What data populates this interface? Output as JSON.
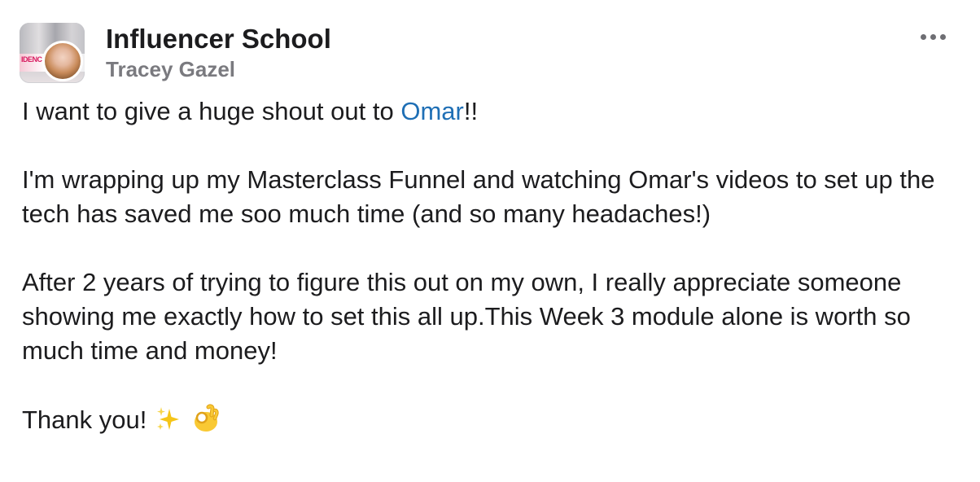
{
  "header": {
    "group_name": "Influencer School",
    "author_name": "Tracey Gazel",
    "avatar_tag": "IDENC"
  },
  "more_menu": {
    "icon": "more-horizontal-icon"
  },
  "post": {
    "line1_prefix": "I want to give a huge shout out to ",
    "mention": "Omar",
    "line1_suffix": "!!",
    "paragraph2": "I'm wrapping up my Masterclass Funnel and watching Omar's videos to set up the tech has saved me soo much time (and so many headaches!)",
    "paragraph3": "After 2 years of trying to figure this out on my own, I really appreciate someone showing me exactly how to set this all up.This Week 3 module alone is worth so much time and money!",
    "closing": "Thank you!",
    "emojis": [
      "sparkles-icon",
      "ok-hand-icon"
    ]
  },
  "colors": {
    "mention": "#1f6fb5",
    "secondary_text": "#7a7a7f",
    "primary_text": "#1c1c1e"
  }
}
